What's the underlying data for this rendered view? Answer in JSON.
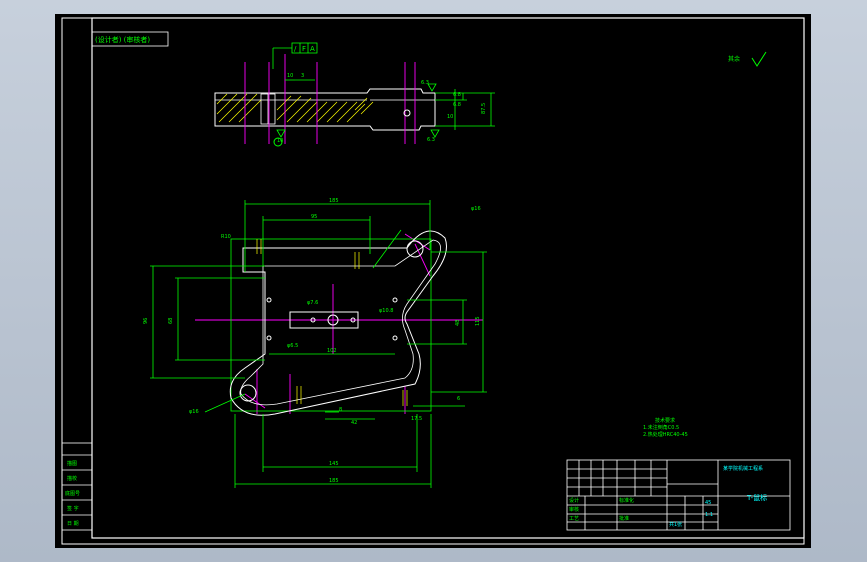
{
  "app": {
    "background": "#b8c2cf",
    "canvas": "#000000"
  },
  "colors": {
    "outline": "#ffffff",
    "dimension": "#00ff00",
    "center": "#ff00ff",
    "hatch": "#ffff00",
    "title_text": "#00ffff"
  },
  "header_tag": "(设计者) (审核者)",
  "roughness": {
    "label": "其余",
    "value": "6.3"
  },
  "top_view": {
    "datum_box": [
      "/",
      "F",
      "A"
    ],
    "dim_labels": [
      "10",
      "3",
      "6.8",
      "6.8",
      "6.3",
      "6.3",
      "10",
      "87.5",
      "10"
    ]
  },
  "plan_view": {
    "dims": {
      "overall_top": "185",
      "inner_top": "95",
      "r_top": "R10",
      "phi_top": "φ16",
      "left_outer": "96",
      "left_inner": "68",
      "right": "115",
      "center_w": "102",
      "hole": "φ7.6",
      "hole_b": "φ6.5",
      "slot": "φ10.8",
      "bottom_1": "145",
      "bottom_2": "185",
      "small_1": "8",
      "small_2": "42",
      "small_3": "17.5",
      "small_4": "6",
      "phi_bottom": "φ16",
      "misc": "48"
    }
  },
  "notes": {
    "title": "技术要求",
    "lines": [
      "1.未注倒角C0.5",
      "2.热处理HRC40-45"
    ]
  },
  "left_strip": [
    "描图",
    "描校",
    "底图号",
    "签 字",
    "日 期"
  ],
  "title_block": {
    "part_name": "T-鼠标",
    "design_unit": "某学院机械工程系",
    "scale": "1:1",
    "material": "45",
    "sheet": "共1张",
    "row_labels": [
      "设计",
      "审核",
      "工艺",
      "标准化",
      "批准"
    ]
  }
}
